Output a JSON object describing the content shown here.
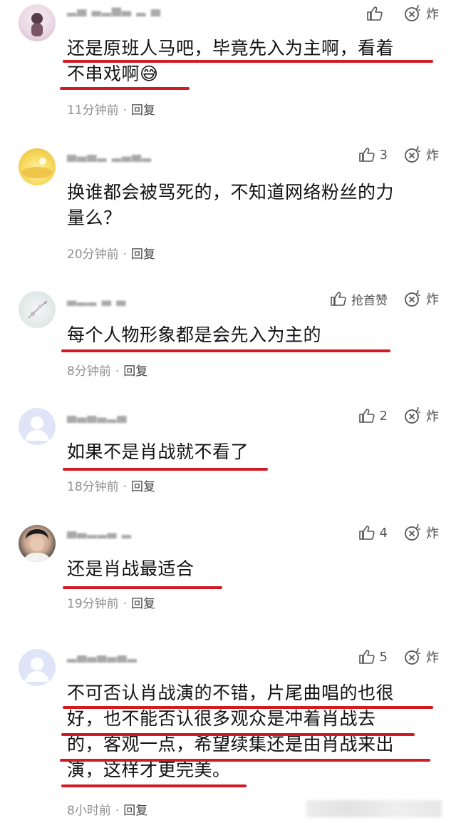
{
  "comments": [
    {
      "username": "▂▄ ▃▂▅▃ ▂ ▄",
      "likes": "",
      "explode": "炸",
      "lines": [
        "还是原班人马吧，毕竟先入为主啊，看着",
        "不串戏啊😅"
      ],
      "time": "11分钟前",
      "reply": "回复"
    },
    {
      "username": "▄▃▄▂ ▂▃▄▂",
      "likes": "3",
      "explode": "炸",
      "lines": [
        "换谁都会被骂死的，不知道网络粉丝的力",
        "量么？"
      ],
      "time": "20分钟前",
      "reply": "回复"
    },
    {
      "username": "▃▂▂ ▃ ▃",
      "likes": "抢首赞",
      "explode": "炸",
      "lines": [
        "每个人物形象都是会先入为主的"
      ],
      "time": "8分钟前",
      "reply": "回复"
    },
    {
      "username": "▄▃▄▃▂▄",
      "likes": "2",
      "explode": "炸",
      "lines": [
        "如果不是肖战就不看了"
      ],
      "time": "18分钟前",
      "reply": "回复"
    },
    {
      "username": "▄▃▂▂▃ ▂",
      "likes": "4",
      "explode": "炸",
      "lines": [
        "还是肖战最适合"
      ],
      "time": "19分钟前",
      "reply": "回复"
    },
    {
      "username": "▂▄▃▄▃▄▂",
      "likes": "5",
      "explode": "炸",
      "lines": [
        "不可否认肖战演的不错，片尾曲唱的也很",
        "好，也不能否认很多观众是冲着肖战去",
        "的，客观一点，希望续集还是由肖战来出",
        "演，这样才更完美。"
      ],
      "time": "8小时前",
      "reply": "回复"
    }
  ]
}
